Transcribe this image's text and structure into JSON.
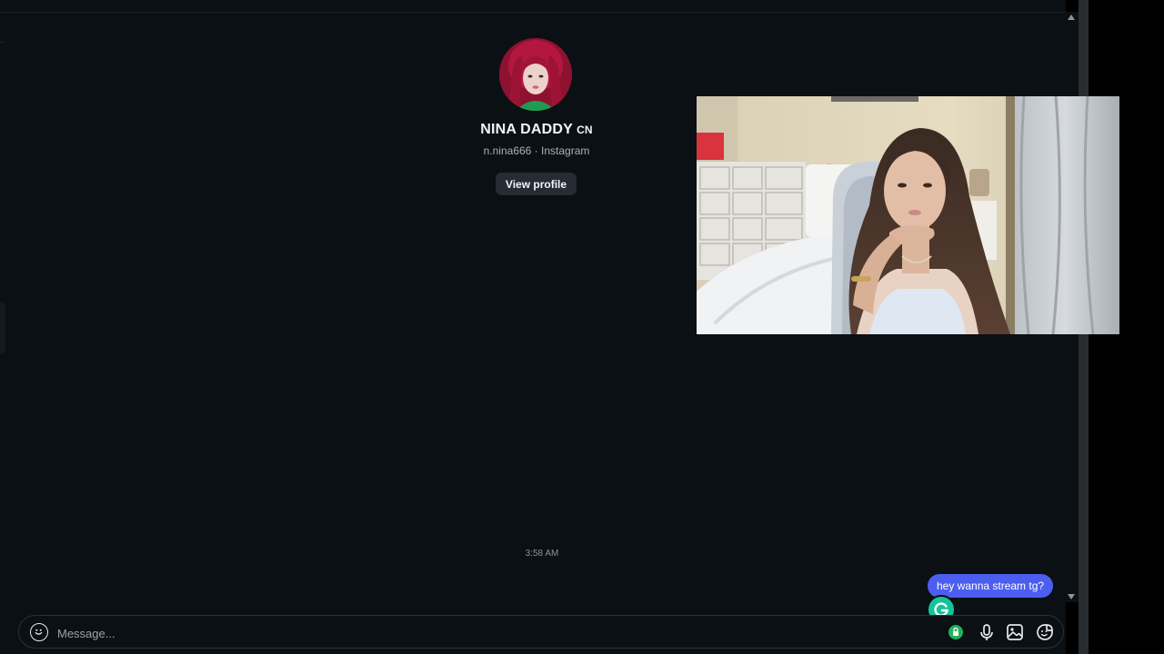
{
  "profile": {
    "name": "NINA DADDY",
    "badge": "CN",
    "subtitle": "n.nina666 · Instagram",
    "view_profile_label": "View profile"
  },
  "conversation": {
    "timestamp": "3:58 AM",
    "messages": [
      {
        "text": "hey wanna stream tg?",
        "from": "me"
      }
    ]
  },
  "composer": {
    "placeholder": "Message...",
    "tools": [
      "grammar-status-icon",
      "microphone-icon",
      "image-icon",
      "sticker-icon"
    ]
  },
  "colors": {
    "background": "#0b1014",
    "bubble": "#4c5ef0",
    "button": "#262c33",
    "grammarly": "#15c39a",
    "text_primary": "#f2f5f7",
    "text_secondary": "#a8b0b8"
  }
}
